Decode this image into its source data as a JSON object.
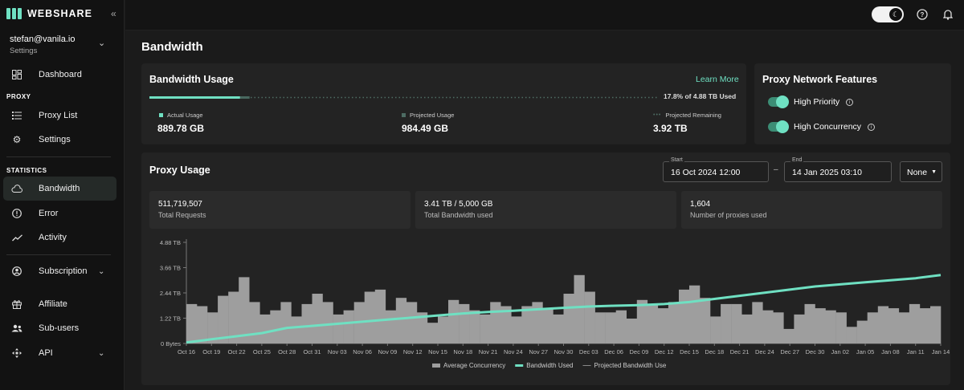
{
  "brand": {
    "name": "WEBSHARE",
    "accent": "#6fe0c2"
  },
  "account": {
    "email": "stefan@vanila.io",
    "subtitle": "Settings"
  },
  "sidebar": {
    "items": [
      {
        "label": "Dashboard",
        "icon": "dashboard-icon"
      },
      {
        "label": "Proxy List",
        "icon": "list-icon"
      },
      {
        "label": "Settings",
        "icon": "gear-icon"
      },
      {
        "label": "Bandwidth",
        "icon": "cloud-icon"
      },
      {
        "label": "Error",
        "icon": "error-icon"
      },
      {
        "label": "Activity",
        "icon": "activity-icon"
      },
      {
        "label": "Subscription",
        "icon": "subscription-icon"
      },
      {
        "label": "Affiliate",
        "icon": "gift-icon"
      },
      {
        "label": "Sub-users",
        "icon": "users-icon"
      },
      {
        "label": "API",
        "icon": "api-icon"
      }
    ],
    "sections": {
      "proxy": "PROXY",
      "statistics": "STATISTICS"
    }
  },
  "page": {
    "title": "Bandwidth"
  },
  "bandwidth_usage": {
    "title": "Bandwidth Usage",
    "learn_more": "Learn More",
    "used_text": "17.8% of 4.88 TB Used",
    "used_fraction": 0.178,
    "projected_fraction": 0.197,
    "actual_label": "Actual Usage",
    "actual_value": "889.78 GB",
    "projected_label": "Projected Usage",
    "projected_value": "984.49 GB",
    "remaining_label": "Projected Remaining",
    "remaining_value": "3.92 TB"
  },
  "features": {
    "title": "Proxy Network Features",
    "items": [
      {
        "label": "High Priority",
        "enabled": true
      },
      {
        "label": "High Concurrency",
        "enabled": true
      }
    ]
  },
  "proxy_usage": {
    "title": "Proxy Usage",
    "start_label": "Start",
    "start_value": "16 Oct 2024 12:00",
    "end_label": "End",
    "end_value": "14 Jan 2025 03:10",
    "separator": "–",
    "group_select": "None",
    "stats": [
      {
        "value": "511,719,507",
        "label": "Total Requests"
      },
      {
        "value": "3.41 TB / 5,000 GB",
        "label": "Total Bandwidth used"
      },
      {
        "value": "1,604",
        "label": "Number of proxies used"
      }
    ]
  },
  "chart_data": {
    "type": "bar",
    "y_tick_labels": [
      "0 Bytes",
      "1.22 TB",
      "2.44 TB",
      "3.66 TB",
      "4.88 TB"
    ],
    "ylim": [
      0,
      4.88
    ],
    "x_tick_labels": [
      "Oct 16",
      "Oct 19",
      "Oct 22",
      "Oct 25",
      "Oct 28",
      "Oct 31",
      "Nov 03",
      "Nov 06",
      "Nov 09",
      "Nov 12",
      "Nov 15",
      "Nov 18",
      "Nov 21",
      "Nov 24",
      "Nov 27",
      "Nov 30",
      "Dec 03",
      "Dec 06",
      "Dec 09",
      "Dec 12",
      "Dec 15",
      "Dec 18",
      "Dec 21",
      "Dec 24",
      "Dec 27",
      "Dec 30",
      "Jan 02",
      "Jan 05",
      "Jan 08",
      "Jan 11",
      "Jan 14"
    ],
    "legend": [
      "Average Concurrency",
      "Bandwidth Used",
      "Projected Bandwidth Use"
    ],
    "series": [
      {
        "name": "Average Concurrency",
        "color": "#9e9e9e",
        "values": [
          1.9,
          1.8,
          1.5,
          2.3,
          2.5,
          3.2,
          2.0,
          1.4,
          1.6,
          2.0,
          1.3,
          1.9,
          2.4,
          2.0,
          1.4,
          1.6,
          2.0,
          2.5,
          2.6,
          1.6,
          2.2,
          2.0,
          1.5,
          1.0,
          1.3,
          2.1,
          1.9,
          1.6,
          1.4,
          2.0,
          1.8,
          1.3,
          1.8,
          2.0,
          1.7,
          1.4,
          2.4,
          3.3,
          2.5,
          1.5,
          1.5,
          1.6,
          1.2,
          2.1,
          1.9,
          1.7,
          2.0,
          2.6,
          2.8,
          2.2,
          1.3,
          1.9,
          1.9,
          1.4,
          2.0,
          1.6,
          1.5,
          0.7,
          1.4,
          1.9,
          1.7,
          1.6,
          1.5,
          0.8,
          1.1,
          1.5,
          1.8,
          1.7,
          1.5,
          1.9,
          1.7,
          1.8
        ]
      },
      {
        "name": "Bandwidth Used",
        "color": "#6fe0c2",
        "values": [
          0.05,
          0.2,
          0.35,
          0.5,
          0.75,
          0.85,
          0.95,
          1.05,
          1.15,
          1.25,
          1.35,
          1.45,
          1.52,
          1.58,
          1.65,
          1.72,
          1.78,
          1.82,
          1.85,
          1.9,
          2.0,
          2.15,
          2.3,
          2.45,
          2.6,
          2.75,
          2.85,
          2.95,
          3.05,
          3.15,
          3.3
        ]
      }
    ],
    "grid": false,
    "legend_position": "bottom"
  }
}
